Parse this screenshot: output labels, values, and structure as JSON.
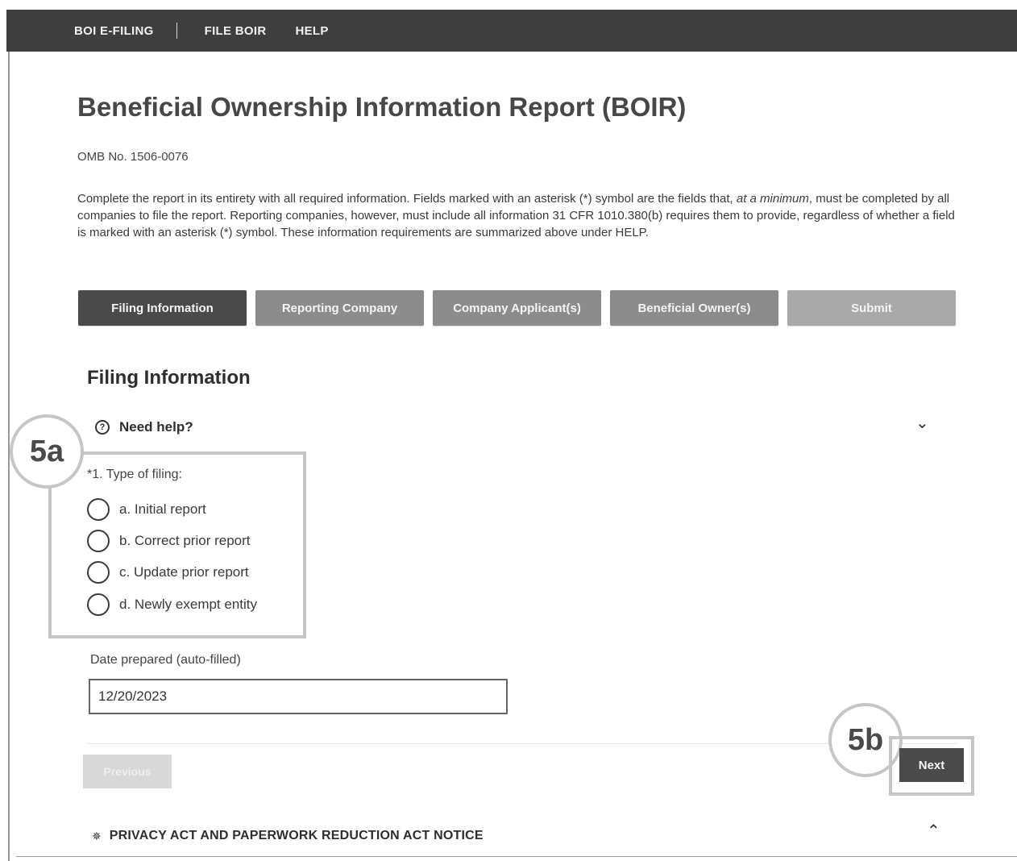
{
  "topbar": {
    "brand": "BOI E-FILING",
    "links": [
      "FILE BOIR",
      "HELP"
    ]
  },
  "header": {
    "title": "Beneficial Ownership Information Report (BOIR)",
    "omb": "OMB No. 1506-0076",
    "intro_before_em": "Complete the report in its entirety with all required information. Fields marked with an asterisk (*) symbol are the fields that, ",
    "intro_em": "at a minimum",
    "intro_after_em": ", must be completed by all companies to file the report. Reporting companies, however, must include all information 31 CFR 1010.380(b) requires them to provide, regardless of whether a field is marked with an asterisk (*) symbol. These information requirements are summarized above under HELP."
  },
  "tabs": [
    {
      "label": "Filing Information",
      "active": true
    },
    {
      "label": "Reporting Company",
      "active": false
    },
    {
      "label": "Company Applicant(s)",
      "active": false
    },
    {
      "label": "Beneficial Owner(s)",
      "active": false
    },
    {
      "label": "Submit",
      "active": false
    }
  ],
  "section": {
    "title": "Filing Information",
    "help_label": "Need help?",
    "help_icon": "question-circle-icon"
  },
  "callouts": {
    "a": "5a",
    "b": "5b"
  },
  "filing_type": {
    "label": "*1. Type of filing:",
    "options": [
      "a. Initial report",
      "b. Correct prior report",
      "c. Update prior report",
      "d. Newly exempt entity"
    ]
  },
  "date_prepared": {
    "label": "Date prepared (auto-filled)",
    "value": "12/20/2023"
  },
  "buttons": {
    "previous": "Previous",
    "next": "Next"
  },
  "privacy": {
    "label": "PRIVACY ACT AND PAPERWORK REDUCTION ACT NOTICE",
    "icon": "megaphone-icon"
  }
}
